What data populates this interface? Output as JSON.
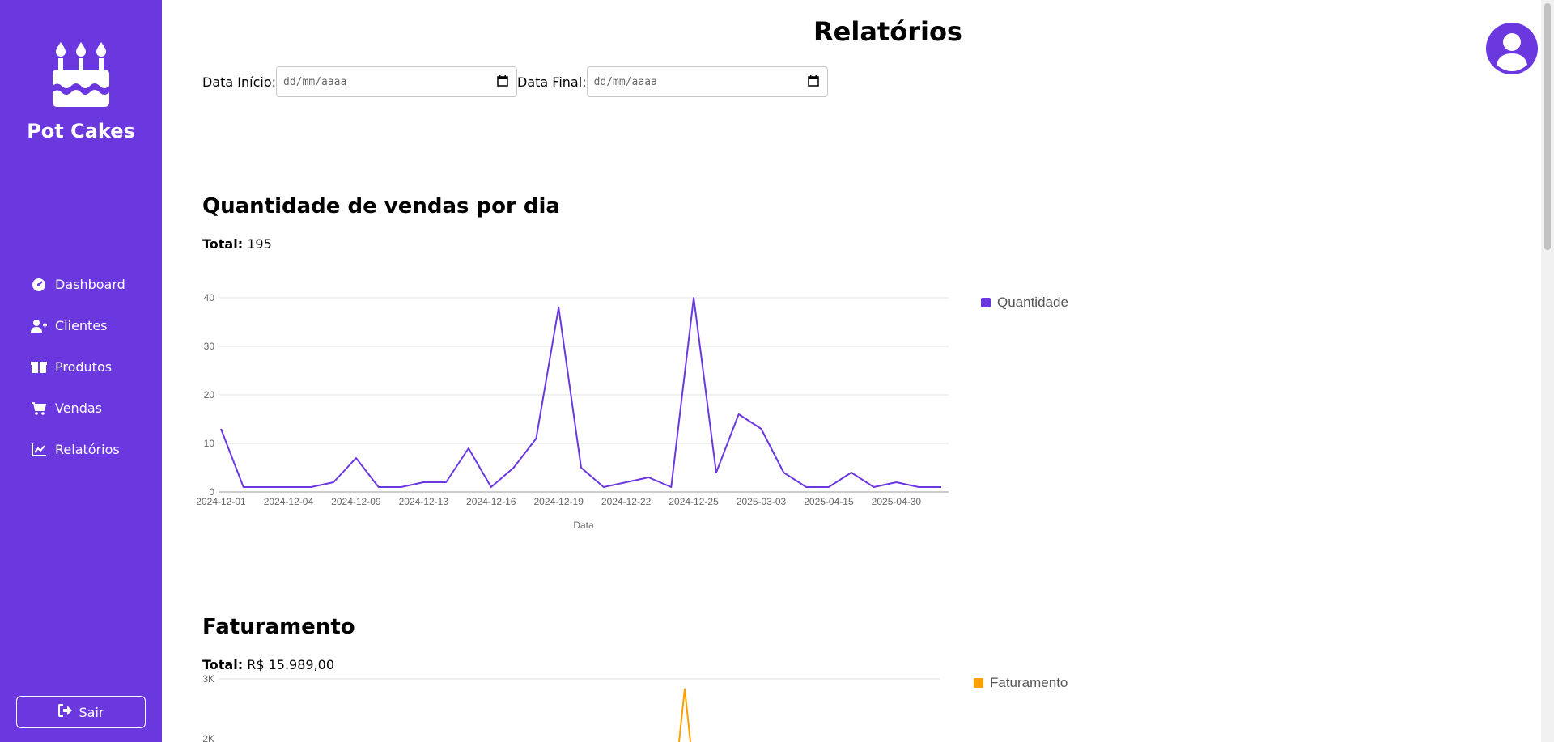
{
  "app": {
    "brand": "Pot Cakes"
  },
  "sidebar": {
    "items": [
      {
        "label": "Dashboard",
        "icon": "gauge-icon"
      },
      {
        "label": "Clientes",
        "icon": "user-plus-icon"
      },
      {
        "label": "Produtos",
        "icon": "boxes-icon"
      },
      {
        "label": "Vendas",
        "icon": "cart-icon"
      },
      {
        "label": "Relatórios",
        "icon": "chart-line-icon"
      }
    ],
    "logout_label": "Sair"
  },
  "header": {
    "title": "Relatórios"
  },
  "filters": {
    "start_label": "Data Início:",
    "start_placeholder": "dd/mm/aaaa",
    "end_label": "Data Final:",
    "end_placeholder": "dd/mm/aaaa"
  },
  "colors": {
    "accent": "#6b38e0",
    "line": "#6b38e0",
    "revenue": "#ff9f00"
  },
  "sales": {
    "title": "Quantidade de vendas por dia",
    "total_label": "Total:",
    "total_value": "195"
  },
  "revenue": {
    "title": "Faturamento",
    "total_label": "Total:",
    "total_value": "R$ 15.989,00"
  },
  "chart_data": [
    {
      "type": "line",
      "series": [
        {
          "name": "Quantidade",
          "values": [
            13,
            1,
            1,
            1,
            1,
            2,
            7,
            1,
            1,
            2,
            2,
            9,
            1,
            5,
            11,
            38,
            5,
            1,
            2,
            3,
            1,
            40,
            4,
            16,
            13,
            4,
            1,
            1,
            4,
            1,
            2,
            1,
            1
          ]
        }
      ],
      "x": [
        "2024-12-01",
        "",
        "",
        "2024-12-04",
        "",
        "",
        "2024-12-09",
        "",
        "",
        "2024-12-13",
        "",
        "",
        "2024-12-16",
        "",
        "",
        "2024-12-19",
        "",
        "",
        "2024-12-22",
        "",
        "",
        "2024-12-25",
        "",
        "",
        "2025-03-03",
        "",
        "",
        "2025-04-15",
        "",
        "",
        "2025-04-30",
        "",
        ""
      ],
      "xlabel": "Data",
      "ylabel": "",
      "ylim": [
        0,
        40
      ],
      "yticks": [
        0,
        10,
        20,
        30,
        40
      ],
      "grid": true,
      "legend": "right"
    },
    {
      "type": "line",
      "series": [
        {
          "name": "Faturamento",
          "values": [
            2900
          ]
        }
      ],
      "yticks_visible": [
        "3K",
        "2K"
      ],
      "grid": true,
      "legend": "right"
    }
  ]
}
